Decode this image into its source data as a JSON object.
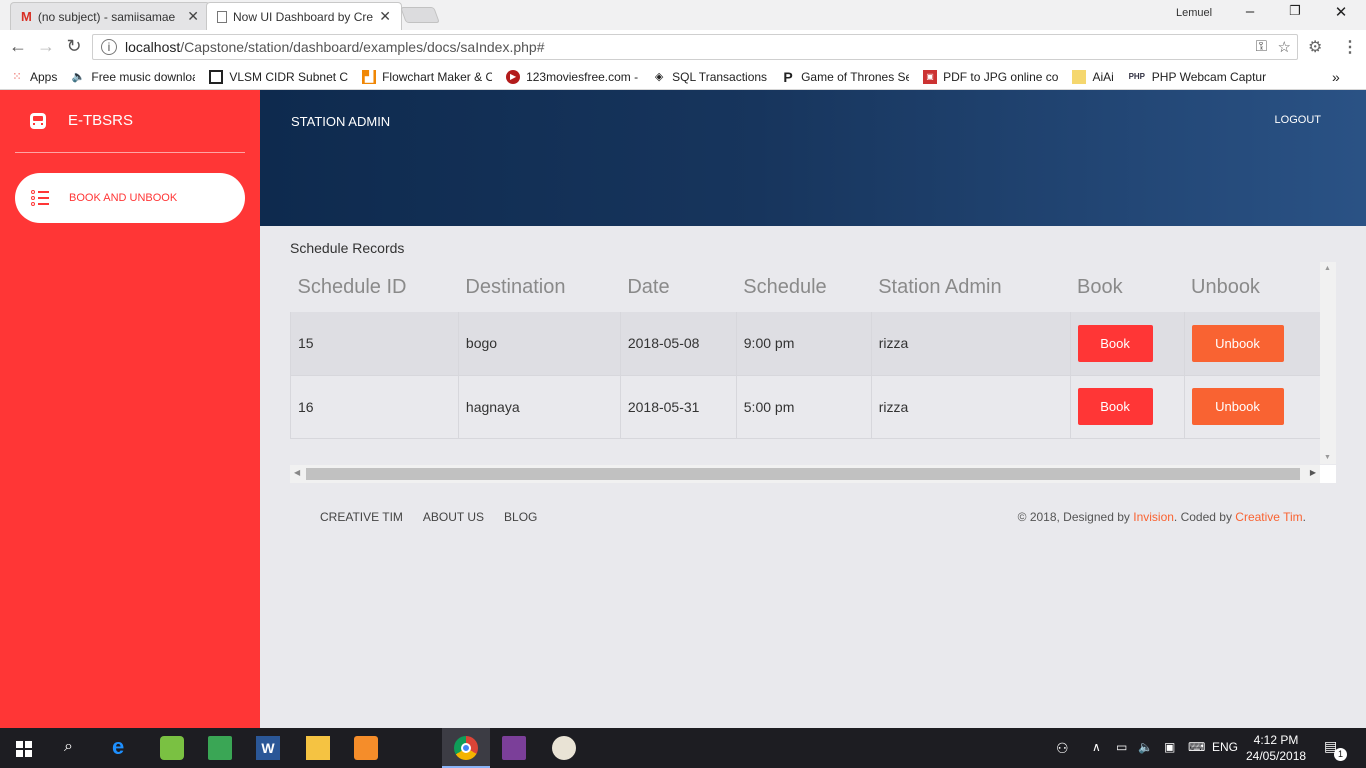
{
  "browser": {
    "tabs": [
      {
        "label": "(no subject) - samiisamae",
        "icon": "gmail-icon"
      },
      {
        "label": "Now UI Dashboard by Cre",
        "icon": "page-icon"
      }
    ],
    "user": "Lemuel",
    "url_host": "localhost",
    "url_path": "/Capstone/station/dashboard/examples/docs/saIndex.php#",
    "bookmarks": [
      {
        "label": "Apps",
        "icon": "apps-grid-icon"
      },
      {
        "label": "Free music download",
        "icon": "speaker-icon"
      },
      {
        "label": "VLSM CIDR Subnet C",
        "icon": "vlsm-icon"
      },
      {
        "label": "Flowchart Maker & O",
        "icon": "flowchart-icon"
      },
      {
        "label": "123moviesfree.com -",
        "icon": "movies-icon"
      },
      {
        "label": "SQL Transactions",
        "icon": "sql-icon"
      },
      {
        "label": "Game of Thrones Se",
        "icon": "p-icon"
      },
      {
        "label": "PDF to JPG online co",
        "icon": "pdf-icon"
      },
      {
        "label": "AiAi",
        "icon": "folder-icon"
      },
      {
        "label": "PHP Webcam Captur",
        "icon": "php-icon"
      }
    ],
    "more": "»"
  },
  "sidebar": {
    "brand": "E-TBSRS",
    "nav_item": "BOOK AND UNBOOK"
  },
  "header": {
    "title": "STATION ADMIN",
    "logout": "LOGOUT"
  },
  "content": {
    "section_title": "Schedule Records",
    "columns": [
      "Schedule ID",
      "Destination",
      "Date",
      "Schedule",
      "Station Admin",
      "Book",
      "Unbook"
    ],
    "rows": [
      {
        "id": "15",
        "destination": "bogo",
        "date": "2018-05-08",
        "schedule": "9:00 pm",
        "admin": "rizza",
        "book": "Book",
        "unbook": "Unbook"
      },
      {
        "id": "16",
        "destination": "hagnaya",
        "date": "2018-05-31",
        "schedule": "5:00 pm",
        "admin": "rizza",
        "book": "Book",
        "unbook": "Unbook"
      }
    ]
  },
  "footer": {
    "links": [
      "CREATIVE TIM",
      "ABOUT US",
      "BLOG"
    ],
    "copy_prefix": "© 2018, Designed by ",
    "designer": "Invision",
    "copy_mid": ". Coded by ",
    "coder": "Creative Tim",
    "copy_suffix": "."
  },
  "taskbar": {
    "time": "4:12 PM",
    "date": "24/05/2018",
    "lang": "ENG",
    "notification_count": "1"
  },
  "colors": {
    "sidebar": "#ff3636",
    "header_dark": "#0e2a4e",
    "accent_orange": "#f96332"
  }
}
